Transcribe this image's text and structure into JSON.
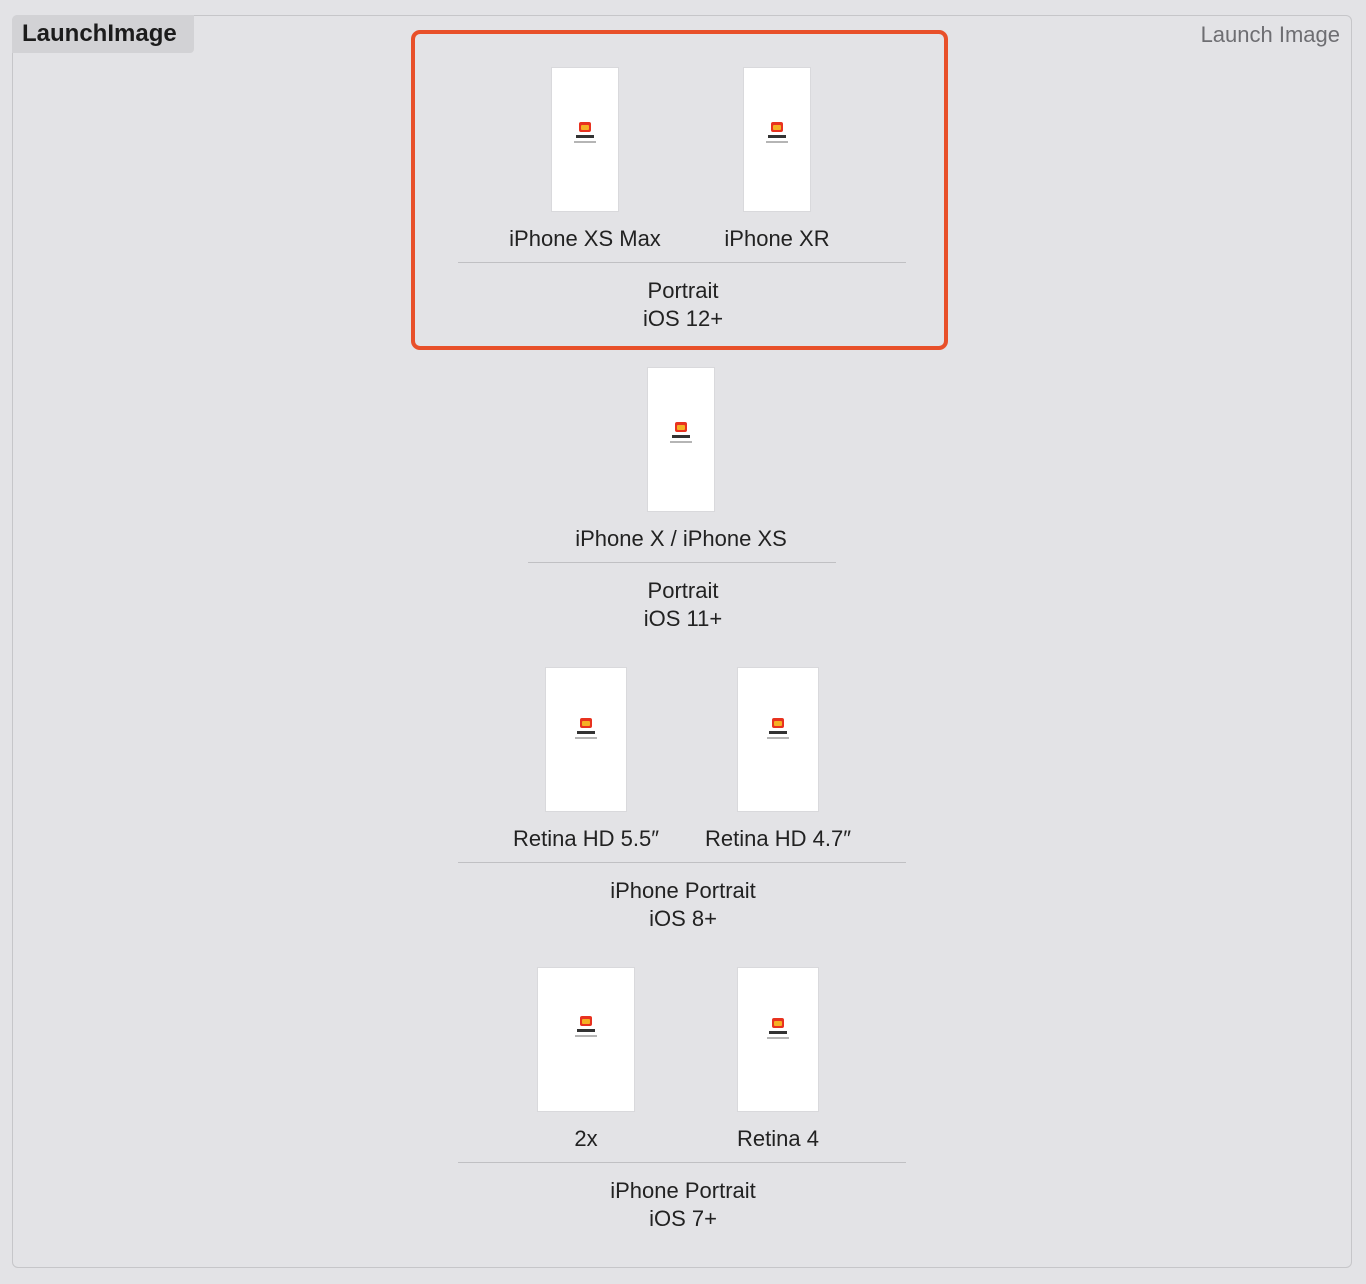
{
  "set_name": "LaunchImage",
  "asset_kind_label": "Launch Image",
  "accent_color": "#e8502a",
  "groups": [
    {
      "slots": [
        {
          "label": "iPhone XS Max"
        },
        {
          "label": "iPhone XR"
        }
      ],
      "orientation": "Portrait",
      "ios": "iOS 12+"
    },
    {
      "slots": [
        {
          "label": "iPhone X / iPhone XS"
        }
      ],
      "orientation": "Portrait",
      "ios": "iOS 11+"
    },
    {
      "slots": [
        {
          "label": "Retina HD 5.5″"
        },
        {
          "label": "Retina HD 4.7″"
        }
      ],
      "orientation": "iPhone Portrait",
      "ios": "iOS 8+"
    },
    {
      "slots": [
        {
          "label": "2x"
        },
        {
          "label": "Retina 4"
        }
      ],
      "orientation": "iPhone Portrait",
      "ios": "iOS 7+"
    }
  ]
}
